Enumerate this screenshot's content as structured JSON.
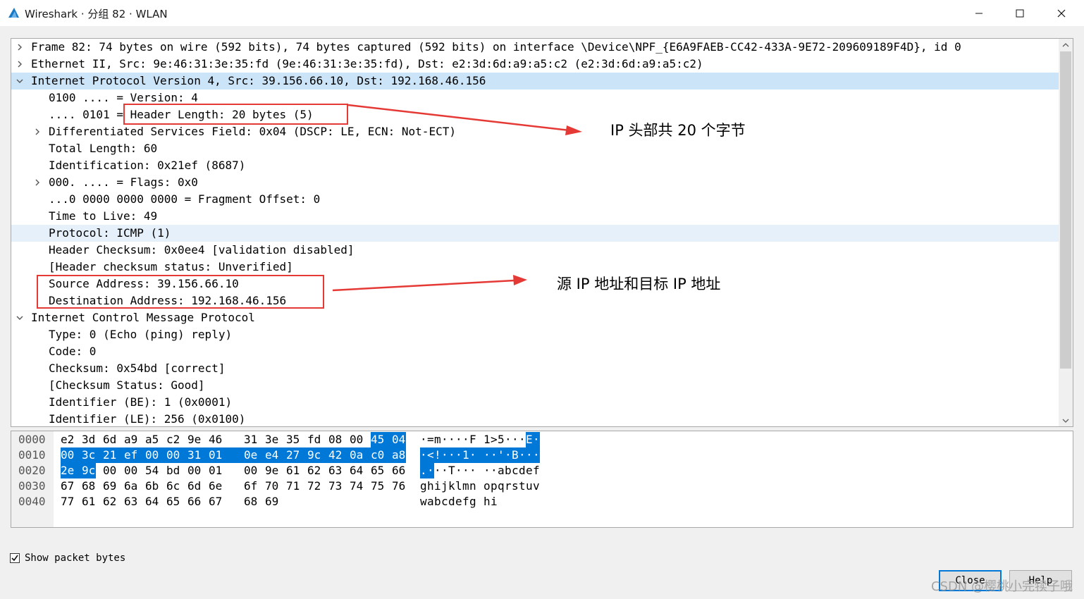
{
  "window": {
    "title": "Wireshark · 分组 82 · WLAN"
  },
  "tree": {
    "rows": [
      "Frame 82: 74 bytes on wire (592 bits), 74 bytes captured (592 bits) on interface \\Device\\NPF_{E6A9FAEB-CC42-433A-9E72-209609189F4D}, id 0",
      "Ethernet II, Src: 9e:46:31:3e:35:fd (9e:46:31:3e:35:fd), Dst: e2:3d:6d:a9:a5:c2 (e2:3d:6d:a9:a5:c2)",
      "Internet Protocol Version 4, Src: 39.156.66.10, Dst: 192.168.46.156",
      "0100 .... = Version: 4",
      ".... 0101 = Header Length: 20 bytes (5)",
      "Differentiated Services Field: 0x04 (DSCP: LE, ECN: Not-ECT)",
      "Total Length: 60",
      "Identification: 0x21ef (8687)",
      "000. .... = Flags: 0x0",
      "...0 0000 0000 0000 = Fragment Offset: 0",
      "Time to Live: 49",
      "Protocol: ICMP (1)",
      "Header Checksum: 0x0ee4 [validation disabled]",
      "[Header checksum status: Unverified]",
      "Source Address: 39.156.66.10",
      "Destination Address: 192.168.46.156",
      "Internet Control Message Protocol",
      "Type: 0 (Echo (ping) reply)",
      "Code: 0",
      "Checksum: 0x54bd [correct]",
      "[Checksum Status: Good]",
      "Identifier (BE): 1 (0x0001)",
      "Identifier (LE): 256 (0x0100)"
    ]
  },
  "hex": {
    "offsets": [
      "0000",
      "0010",
      "0020",
      "0030",
      "0040"
    ],
    "bytes": [
      [
        "e2",
        "3d",
        "6d",
        "a9",
        "a5",
        "c2",
        "9e",
        "46",
        "31",
        "3e",
        "35",
        "fd",
        "08",
        "00",
        "45",
        "04"
      ],
      [
        "00",
        "3c",
        "21",
        "ef",
        "00",
        "00",
        "31",
        "01",
        "0e",
        "e4",
        "27",
        "9c",
        "42",
        "0a",
        "c0",
        "a8"
      ],
      [
        "2e",
        "9c",
        "00",
        "00",
        "54",
        "bd",
        "00",
        "01",
        "00",
        "9e",
        "61",
        "62",
        "63",
        "64",
        "65",
        "66"
      ],
      [
        "67",
        "68",
        "69",
        "6a",
        "6b",
        "6c",
        "6d",
        "6e",
        "6f",
        "70",
        "71",
        "72",
        "73",
        "74",
        "75",
        "76"
      ],
      [
        "77",
        "61",
        "62",
        "63",
        "64",
        "65",
        "66",
        "67",
        "68",
        "69"
      ]
    ],
    "ascii": [
      [
        "·",
        "=",
        "m",
        "·",
        "·",
        "·",
        "·",
        "F",
        "1",
        ">",
        "5",
        "·",
        "·",
        "·",
        "E",
        "·"
      ],
      [
        "·",
        "<",
        "!",
        "·",
        "·",
        "·",
        "1",
        "·",
        "·",
        "·",
        "'",
        "·",
        "B",
        "·",
        "·",
        "·"
      ],
      [
        ".",
        "·",
        "·",
        "·",
        "T",
        "·",
        "·",
        "·",
        "·",
        "·",
        "a",
        "b",
        "c",
        "d",
        "e",
        "f"
      ],
      [
        "g",
        "h",
        "i",
        "j",
        "k",
        "l",
        "m",
        "n",
        "o",
        "p",
        "q",
        "r",
        "s",
        "t",
        "u",
        "v"
      ],
      [
        "w",
        "a",
        "b",
        "c",
        "d",
        "e",
        "f",
        "g",
        "h",
        "i"
      ]
    ]
  },
  "annotations": {
    "header_note": "IP 头部共 20 个字节",
    "address_note": "源 IP 地址和目标 IP 地址"
  },
  "footer": {
    "show_bytes_label": "Show packet bytes",
    "show_bytes_checked": true,
    "close_label": "Close",
    "help_label": "Help",
    "watermark": "CSDN @樱桃小完犊子哦"
  }
}
